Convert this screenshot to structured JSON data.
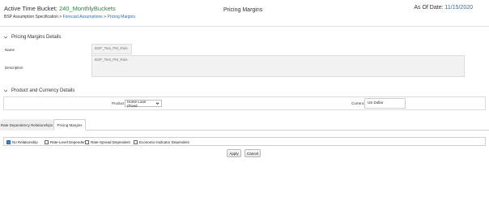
{
  "header": {
    "bucket_label": "Active Time Bucket:",
    "bucket_value": "240_MonthlyBuckets",
    "crumb_1": "BSP Assumption Specification",
    "crumb_sep_1": " > ",
    "crumb_2": "Forecast Assumptions",
    "crumb_sep_2": " > ",
    "crumb_3": "Pricing Margins",
    "title": "Pricing Margins",
    "as_of_label": "As Of Date:",
    "as_of_value": "11/15/2020"
  },
  "details_section": {
    "title": "Pricing Margins Details",
    "name_label": "Name",
    "name_value": "BSP_Test_PM_Rule",
    "description_label": "Description",
    "description_value": "BSP_Test_PM_Rule"
  },
  "product_section": {
    "title": "Product and Currency Details",
    "product_label": "Product",
    "product_value": "Home Loan (Fixed",
    "currency_label": "Currency",
    "currency_value": "US Dollar"
  },
  "tabs": [
    {
      "label": "Rate Dependency Relationships",
      "active": false
    },
    {
      "label": "Pricing Margins",
      "active": true
    }
  ],
  "checkboxes": [
    {
      "label": "No Relationship",
      "checked": true
    },
    {
      "label": "Rate-Level Dependent",
      "checked": false
    },
    {
      "label": "Rate-Spread Dependent",
      "checked": false
    },
    {
      "label": "Economic-Indicator Dependent",
      "checked": false
    }
  ],
  "buttons": {
    "apply": "Apply",
    "cancel": "Cancel"
  },
  "colors": {
    "accent_green": "#2a8a3e",
    "link_blue": "#2b6cb0"
  },
  "icons": {
    "section_toggle": "chevron-down-icon",
    "select_arrow": "chevron-down-icon",
    "check": "checkmark-icon"
  }
}
